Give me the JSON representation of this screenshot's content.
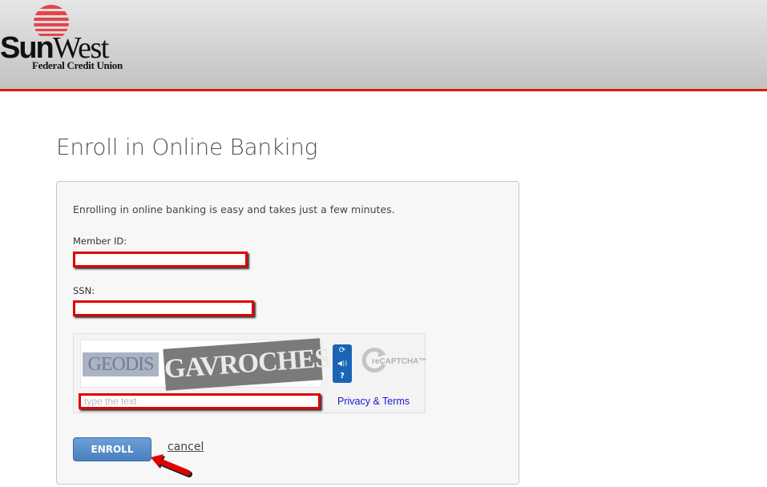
{
  "brand": {
    "name_bold": "Sun",
    "name_regular": "West",
    "subtitle": "Federal Credit Union",
    "accent_color": "#d41c0c"
  },
  "page": {
    "title": "Enroll in Online Banking"
  },
  "form": {
    "intro": "Enrolling in online banking is easy and takes just a few minutes.",
    "member_id": {
      "label": "Member ID:",
      "value": ""
    },
    "ssn": {
      "label": "SSN:",
      "value": ""
    },
    "captcha": {
      "word1": "GEODIS",
      "word2": "GAVROCHES",
      "input_placeholder": "type the text",
      "input_value": "",
      "buttons": [
        {
          "name": "refresh-icon",
          "glyph": "⟳"
        },
        {
          "name": "audio-icon",
          "glyph": "◀))"
        },
        {
          "name": "help-icon",
          "glyph": "?"
        }
      ],
      "logo_text": "reCAPTCHA™",
      "privacy_link": "Privacy & Terms"
    },
    "enroll_label": "ENROLL",
    "cancel_label": "cancel"
  }
}
